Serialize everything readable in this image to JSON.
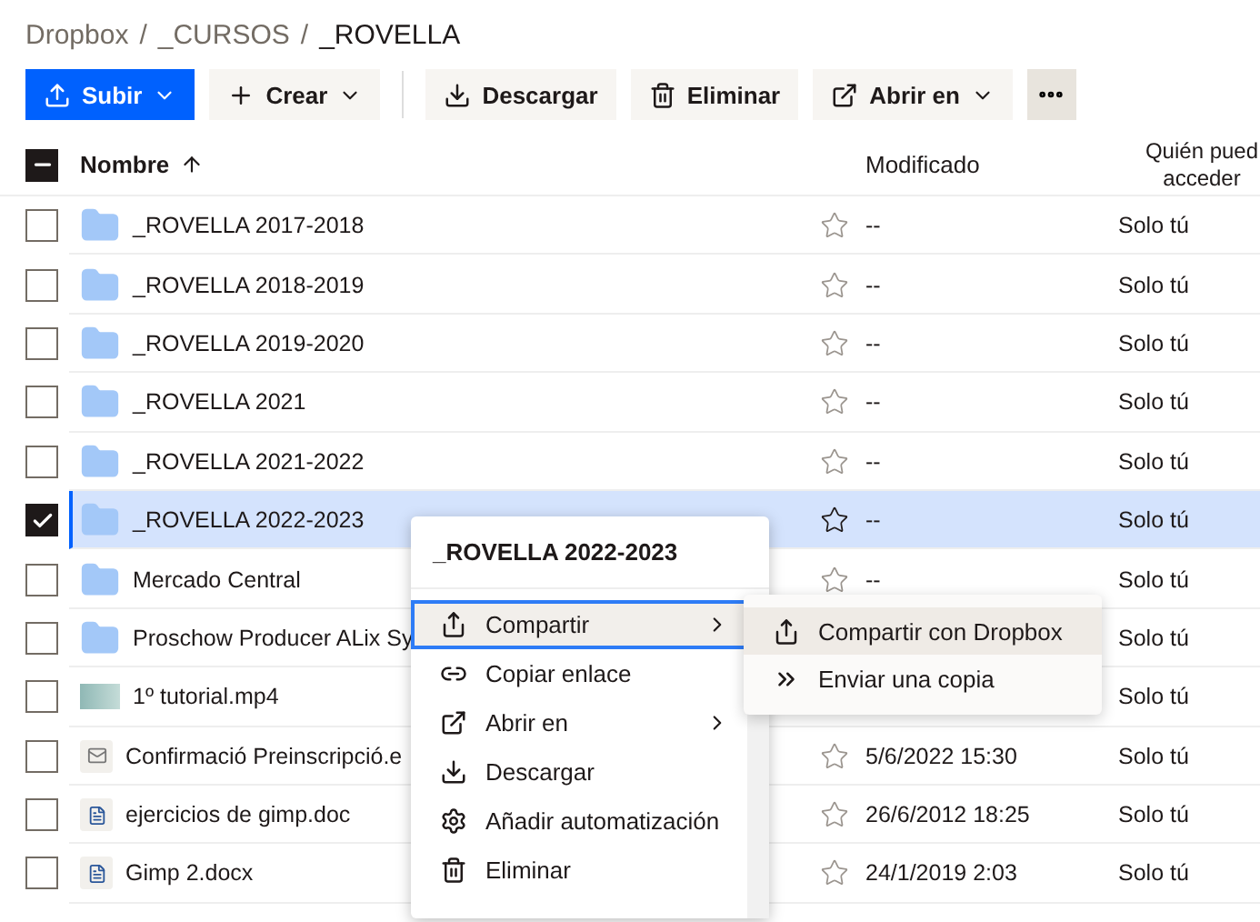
{
  "breadcrumb": [
    {
      "label": "Dropbox"
    },
    {
      "separator": "/",
      "label": "_CURSOS"
    },
    {
      "separator": "/",
      "label": "_ROVELLA"
    }
  ],
  "toolbar": [
    {
      "label": "Subir",
      "primary": true,
      "dropdown": true
    },
    {
      "label": "Crear",
      "primary": false,
      "dropdown": true
    },
    {
      "label": "Descargar",
      "primary": false,
      "dropdown": false
    },
    {
      "label": "Eliminar",
      "primary": false,
      "dropdown": false
    },
    {
      "label": "Abrir en",
      "primary": false,
      "dropdown": true
    }
  ],
  "table": {
    "select_all": {
      "indeterminate": true
    },
    "columns": [
      "Nombre",
      "Modificado",
      "Quién pued acceder"
    ],
    "rows": [
      {
        "name": "_ROVELLA 2017-2018",
        "kind": "folder",
        "modified": "--",
        "access": "Solo tú",
        "selected": false
      },
      {
        "name": "_ROVELLA 2018-2019",
        "kind": "folder",
        "modified": "--",
        "access": "Solo tú",
        "selected": false
      },
      {
        "name": "_ROVELLA 2019-2020",
        "kind": "folder",
        "modified": "--",
        "access": "Solo tú",
        "selected": false
      },
      {
        "name": "_ROVELLA 2021",
        "kind": "folder",
        "modified": "--",
        "access": "Solo tú",
        "selected": false
      },
      {
        "name": "_ROVELLA 2021-2022",
        "kind": "folder",
        "modified": "--",
        "access": "Solo tú",
        "selected": false
      },
      {
        "name": "_ROVELLA 2022-2023",
        "kind": "folder",
        "modified": "--",
        "access": "Solo tú",
        "selected": true
      },
      {
        "name": "Mercado Central",
        "kind": "folder",
        "modified": "--",
        "access": "Solo tú",
        "selected": false
      },
      {
        "name": "Proschow Producer ALix Sy",
        "kind": "folder",
        "access": "Solo tú",
        "selected": false
      },
      {
        "name": "1º tutorial.mp4",
        "kind": "video",
        "access": "Solo tú",
        "selected": false
      },
      {
        "name": "Confirmació Preinscripció.e",
        "kind": "email",
        "modified": "5/6/2022 15:30",
        "access": "Solo tú",
        "selected": false
      },
      {
        "name": "ejercicios de gimp.doc",
        "kind": "doc",
        "modified": "26/6/2012 18:25",
        "access": "Solo tú",
        "selected": false
      },
      {
        "name": "Gimp 2.docx",
        "kind": "doc",
        "modified": "24/1/2019 2:03",
        "access": "Solo tú",
        "selected": false
      }
    ]
  },
  "context_menu": {
    "title": "_ROVELLA 2022-2023",
    "items": [
      {
        "label": "Compartir",
        "submenu": true,
        "selected": true
      },
      {
        "label": "Copiar enlace",
        "submenu": false,
        "selected": false
      },
      {
        "label": "Abrir en",
        "submenu": true,
        "selected": false
      },
      {
        "label": "Descargar",
        "submenu": false,
        "selected": false
      },
      {
        "label": "Añadir automatización",
        "submenu": false,
        "selected": false
      },
      {
        "label": "Eliminar",
        "submenu": false,
        "selected": false
      }
    ]
  },
  "submenu": {
    "items": [
      {
        "label": "Compartir con Dropbox",
        "selected": true
      },
      {
        "label": "Enviar una copia",
        "selected": false
      }
    ]
  }
}
